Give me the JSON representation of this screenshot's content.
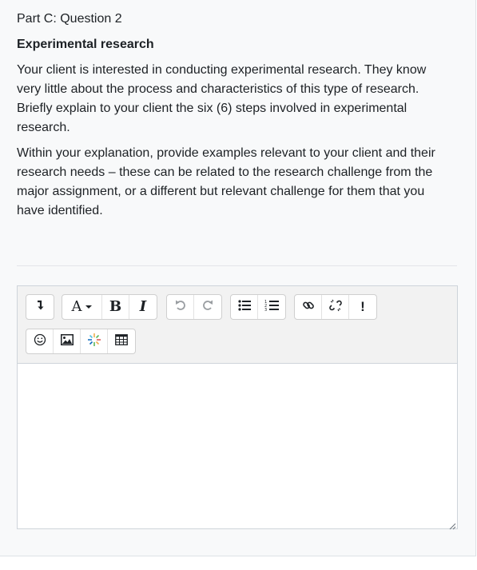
{
  "question": {
    "number": "Part C: Question 2",
    "heading": "Experimental research",
    "paragraphs": [
      "Your client is interested in conducting experimental research. They know very little about the process and characteristics of this type of research. Briefly explain to your client the six (6) steps involved in experimental research.",
      "Within your explanation, provide examples relevant to your client and their research needs – these can be related to the research challenge from the major assignment, or a different but relevant challenge for them that you have identified."
    ]
  },
  "editor": {
    "content": "",
    "toolbar": {
      "row1": [
        [
          "collapse-icon",
          "font-style-icon"
        ],
        [
          "bold-icon",
          "italic-icon"
        ],
        [
          "undo-icon",
          "redo-icon"
        ],
        [
          "unordered-list-icon",
          "ordered-list-icon"
        ],
        [
          "link-icon",
          "unlink-icon",
          "no-autolink-icon"
        ]
      ],
      "row2": [
        [
          "emoji-icon",
          "image-icon",
          "media-icon",
          "table-icon"
        ]
      ]
    },
    "accent_color": "#1d2125",
    "toolbar_bg": "#f2f2f2"
  }
}
